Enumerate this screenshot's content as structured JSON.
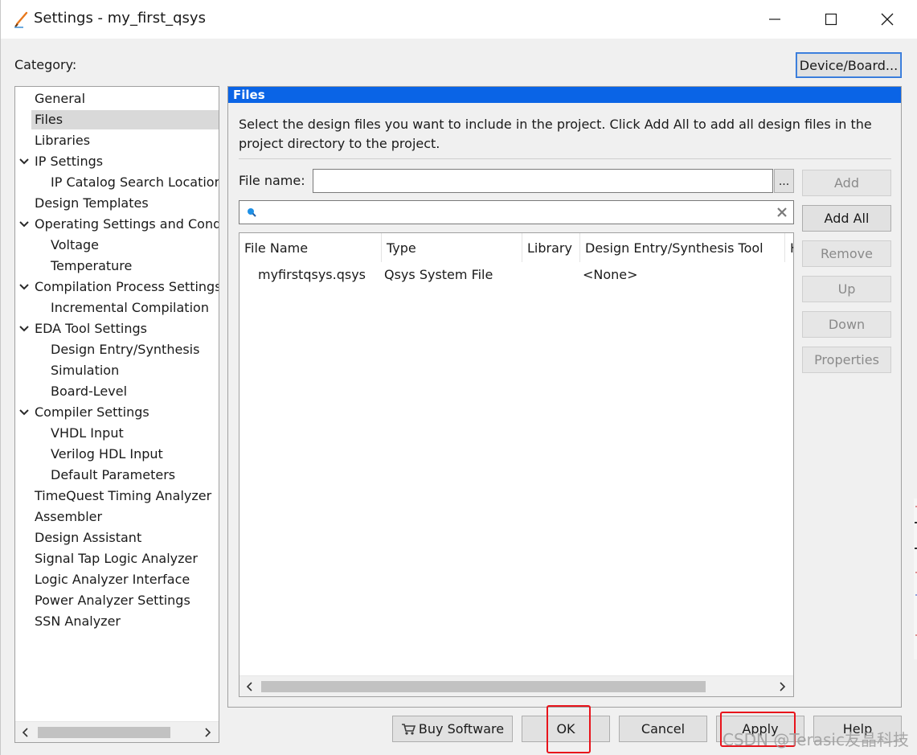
{
  "window": {
    "title": "Settings - my_first_qsys",
    "minimize": "minimize",
    "maximize": "maximize",
    "close": "close"
  },
  "category_label": "Category:",
  "device_board_button": "Device/Board...",
  "tree": {
    "items": [
      {
        "label": "General",
        "level": 0,
        "expandable": false,
        "selected": false
      },
      {
        "label": "Files",
        "level": 0,
        "expandable": false,
        "selected": true
      },
      {
        "label": "Libraries",
        "level": 0,
        "expandable": false,
        "selected": false
      },
      {
        "label": "IP Settings",
        "level": 0,
        "expandable": true,
        "selected": false
      },
      {
        "label": "IP Catalog Search Locations",
        "level": 1,
        "expandable": false,
        "selected": false
      },
      {
        "label": "Design Templates",
        "level": 0,
        "expandable": false,
        "selected": false
      },
      {
        "label": "Operating Settings and Conditions",
        "level": 0,
        "expandable": true,
        "selected": false
      },
      {
        "label": "Voltage",
        "level": 1,
        "expandable": false,
        "selected": false
      },
      {
        "label": "Temperature",
        "level": 1,
        "expandable": false,
        "selected": false
      },
      {
        "label": "Compilation Process Settings",
        "level": 0,
        "expandable": true,
        "selected": false
      },
      {
        "label": "Incremental Compilation",
        "level": 1,
        "expandable": false,
        "selected": false
      },
      {
        "label": "EDA Tool Settings",
        "level": 0,
        "expandable": true,
        "selected": false
      },
      {
        "label": "Design Entry/Synthesis",
        "level": 1,
        "expandable": false,
        "selected": false
      },
      {
        "label": "Simulation",
        "level": 1,
        "expandable": false,
        "selected": false
      },
      {
        "label": "Board-Level",
        "level": 1,
        "expandable": false,
        "selected": false
      },
      {
        "label": "Compiler Settings",
        "level": 0,
        "expandable": true,
        "selected": false
      },
      {
        "label": "VHDL Input",
        "level": 1,
        "expandable": false,
        "selected": false
      },
      {
        "label": "Verilog HDL Input",
        "level": 1,
        "expandable": false,
        "selected": false
      },
      {
        "label": "Default Parameters",
        "level": 1,
        "expandable": false,
        "selected": false
      },
      {
        "label": "TimeQuest Timing Analyzer",
        "level": 0,
        "expandable": false,
        "selected": false
      },
      {
        "label": "Assembler",
        "level": 0,
        "expandable": false,
        "selected": false
      },
      {
        "label": "Design Assistant",
        "level": 0,
        "expandable": false,
        "selected": false
      },
      {
        "label": "Signal Tap Logic Analyzer",
        "level": 0,
        "expandable": false,
        "selected": false
      },
      {
        "label": "Logic Analyzer Interface",
        "level": 0,
        "expandable": false,
        "selected": false
      },
      {
        "label": "Power Analyzer Settings",
        "level": 0,
        "expandable": false,
        "selected": false
      },
      {
        "label": "SSN Analyzer",
        "level": 0,
        "expandable": false,
        "selected": false
      }
    ]
  },
  "files_panel": {
    "header": "Files",
    "description": "Select the design files you want to include in the project. Click Add All to add all design files in the project directory to the project.",
    "file_name_label": "File name:",
    "file_name_value": "",
    "browse_button": "...",
    "filter_value": "",
    "buttons": {
      "add": "Add",
      "add_all": "Add All",
      "remove": "Remove",
      "up": "Up",
      "down": "Down",
      "properties": "Properties"
    },
    "table": {
      "columns": [
        "File Name",
        "Type",
        "Library",
        "Design Entry/Synthesis Tool",
        "HDL Version"
      ],
      "rows": [
        {
          "file_name": "myfirstqsys.qsys",
          "type": "Qsys System File",
          "library": "",
          "tool": "<None>",
          "hdl": ""
        }
      ]
    }
  },
  "footer": {
    "buy_software": "Buy Software",
    "ok": "OK",
    "cancel": "Cancel",
    "apply": "Apply",
    "help": "Help"
  },
  "watermark": "CSDN @Terasic友晶科技",
  "colors": {
    "header_blue": "#0a64e6",
    "highlight_red": "#e8131b",
    "selected_row": "#d9d9d9"
  }
}
